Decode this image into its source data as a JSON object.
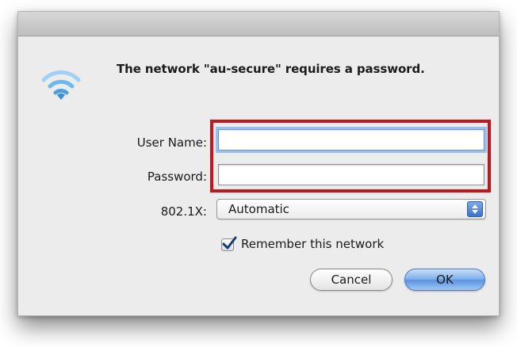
{
  "dialog": {
    "message": "The network \"au-secure\" requires a password.",
    "icon": "wifi-icon"
  },
  "form": {
    "user_name": {
      "label": "User Name:",
      "value": "",
      "placeholder": ""
    },
    "password": {
      "label": "Password:",
      "value": "",
      "placeholder": ""
    },
    "security": {
      "label": "802.1X:",
      "selected": "Automatic"
    },
    "remember": {
      "label": "Remember this network",
      "checked": true
    }
  },
  "buttons": {
    "cancel": "Cancel",
    "ok": "OK"
  },
  "colors": {
    "highlight_border": "#c4161f",
    "wifi_blue": "#5ea9e6",
    "focus_ring": "#9cc0ec",
    "default_button": "#5b93e0"
  }
}
